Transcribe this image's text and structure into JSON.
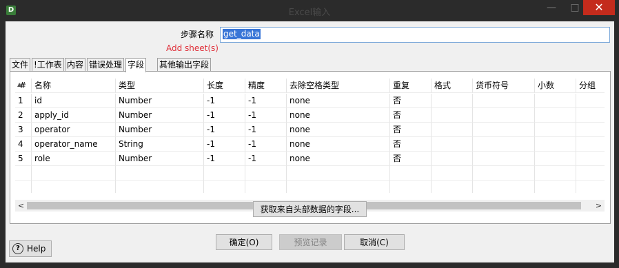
{
  "window": {
    "app_icon_letter": "D",
    "title": "Excel输入",
    "min": "—",
    "max": "□",
    "close": "✕"
  },
  "step": {
    "label": "步骤名称",
    "value": "get_data",
    "warning": "Add sheet(s)"
  },
  "tabs": [
    {
      "label": "文件"
    },
    {
      "label": "!工作表"
    },
    {
      "label": "内容"
    },
    {
      "label": "错误处理"
    },
    {
      "label": "字段"
    },
    {
      "label": "其他输出字段"
    }
  ],
  "active_tab": "字段",
  "table": {
    "sort_indicator": "▲",
    "columns": [
      "#",
      "名称",
      "类型",
      "长度",
      "精度",
      "去除空格类型",
      "重复",
      "格式",
      "货币符号",
      "小数",
      "分组"
    ],
    "rows": [
      [
        "1",
        "id",
        "Number",
        "-1",
        "-1",
        "none",
        "否",
        "",
        "",
        "",
        ""
      ],
      [
        "2",
        "apply_id",
        "Number",
        "-1",
        "-1",
        "none",
        "否",
        "",
        "",
        "",
        ""
      ],
      [
        "3",
        "operator",
        "Number",
        "-1",
        "-1",
        "none",
        "否",
        "",
        "",
        "",
        ""
      ],
      [
        "4",
        "operator_name",
        "String",
        "-1",
        "-1",
        "none",
        "否",
        "",
        "",
        "",
        ""
      ],
      [
        "5",
        "role",
        "Number",
        "-1",
        "-1",
        "none",
        "否",
        "",
        "",
        "",
        ""
      ]
    ]
  },
  "scrollbar": {
    "left": "<",
    "right": ">"
  },
  "buttons": {
    "get_fields": "获取来自头部数据的字段...",
    "ok": "确定(O)",
    "preview": "预览记录",
    "cancel": "取消(C)",
    "help": "Help",
    "help_icon": "?"
  }
}
